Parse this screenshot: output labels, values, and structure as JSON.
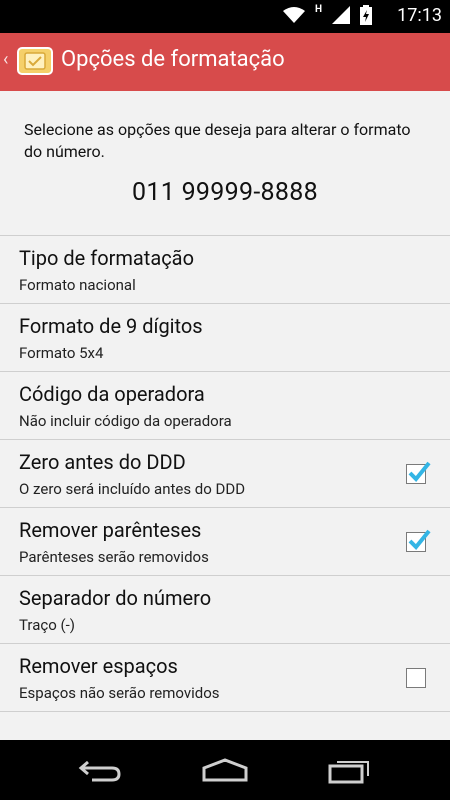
{
  "status": {
    "time": "17:13"
  },
  "actionbar": {
    "title": "Opções de formatação"
  },
  "description": "Selecione as opções que deseja para alterar o formato do número.",
  "number": "011 99999-8888",
  "items": [
    {
      "title": "Tipo de formatação",
      "summary": "Formato nacional"
    },
    {
      "title": "Formato de 9 dígitos",
      "summary": "Formato 5x4"
    },
    {
      "title": "Código da operadora",
      "summary": "Não incluir código da operadora"
    },
    {
      "title": "Zero antes do DDD",
      "summary": "O zero será incluído antes do DDD",
      "checked": true
    },
    {
      "title": "Remover parênteses",
      "summary": "Parênteses serão removidos",
      "checked": true
    },
    {
      "title": "Separador do número",
      "summary": "Traço (-)"
    },
    {
      "title": "Remover espaços",
      "summary": "Espaços não serão removidos",
      "checked": false
    }
  ],
  "colors": {
    "actionbar": "#d74b4b",
    "check": "#33b5e5"
  },
  "icons": {
    "wifi": "wifi-icon",
    "signal": "signal-icon",
    "battery": "battery-icon",
    "back": "back-icon",
    "home": "home-icon",
    "recents": "recents-icon"
  }
}
